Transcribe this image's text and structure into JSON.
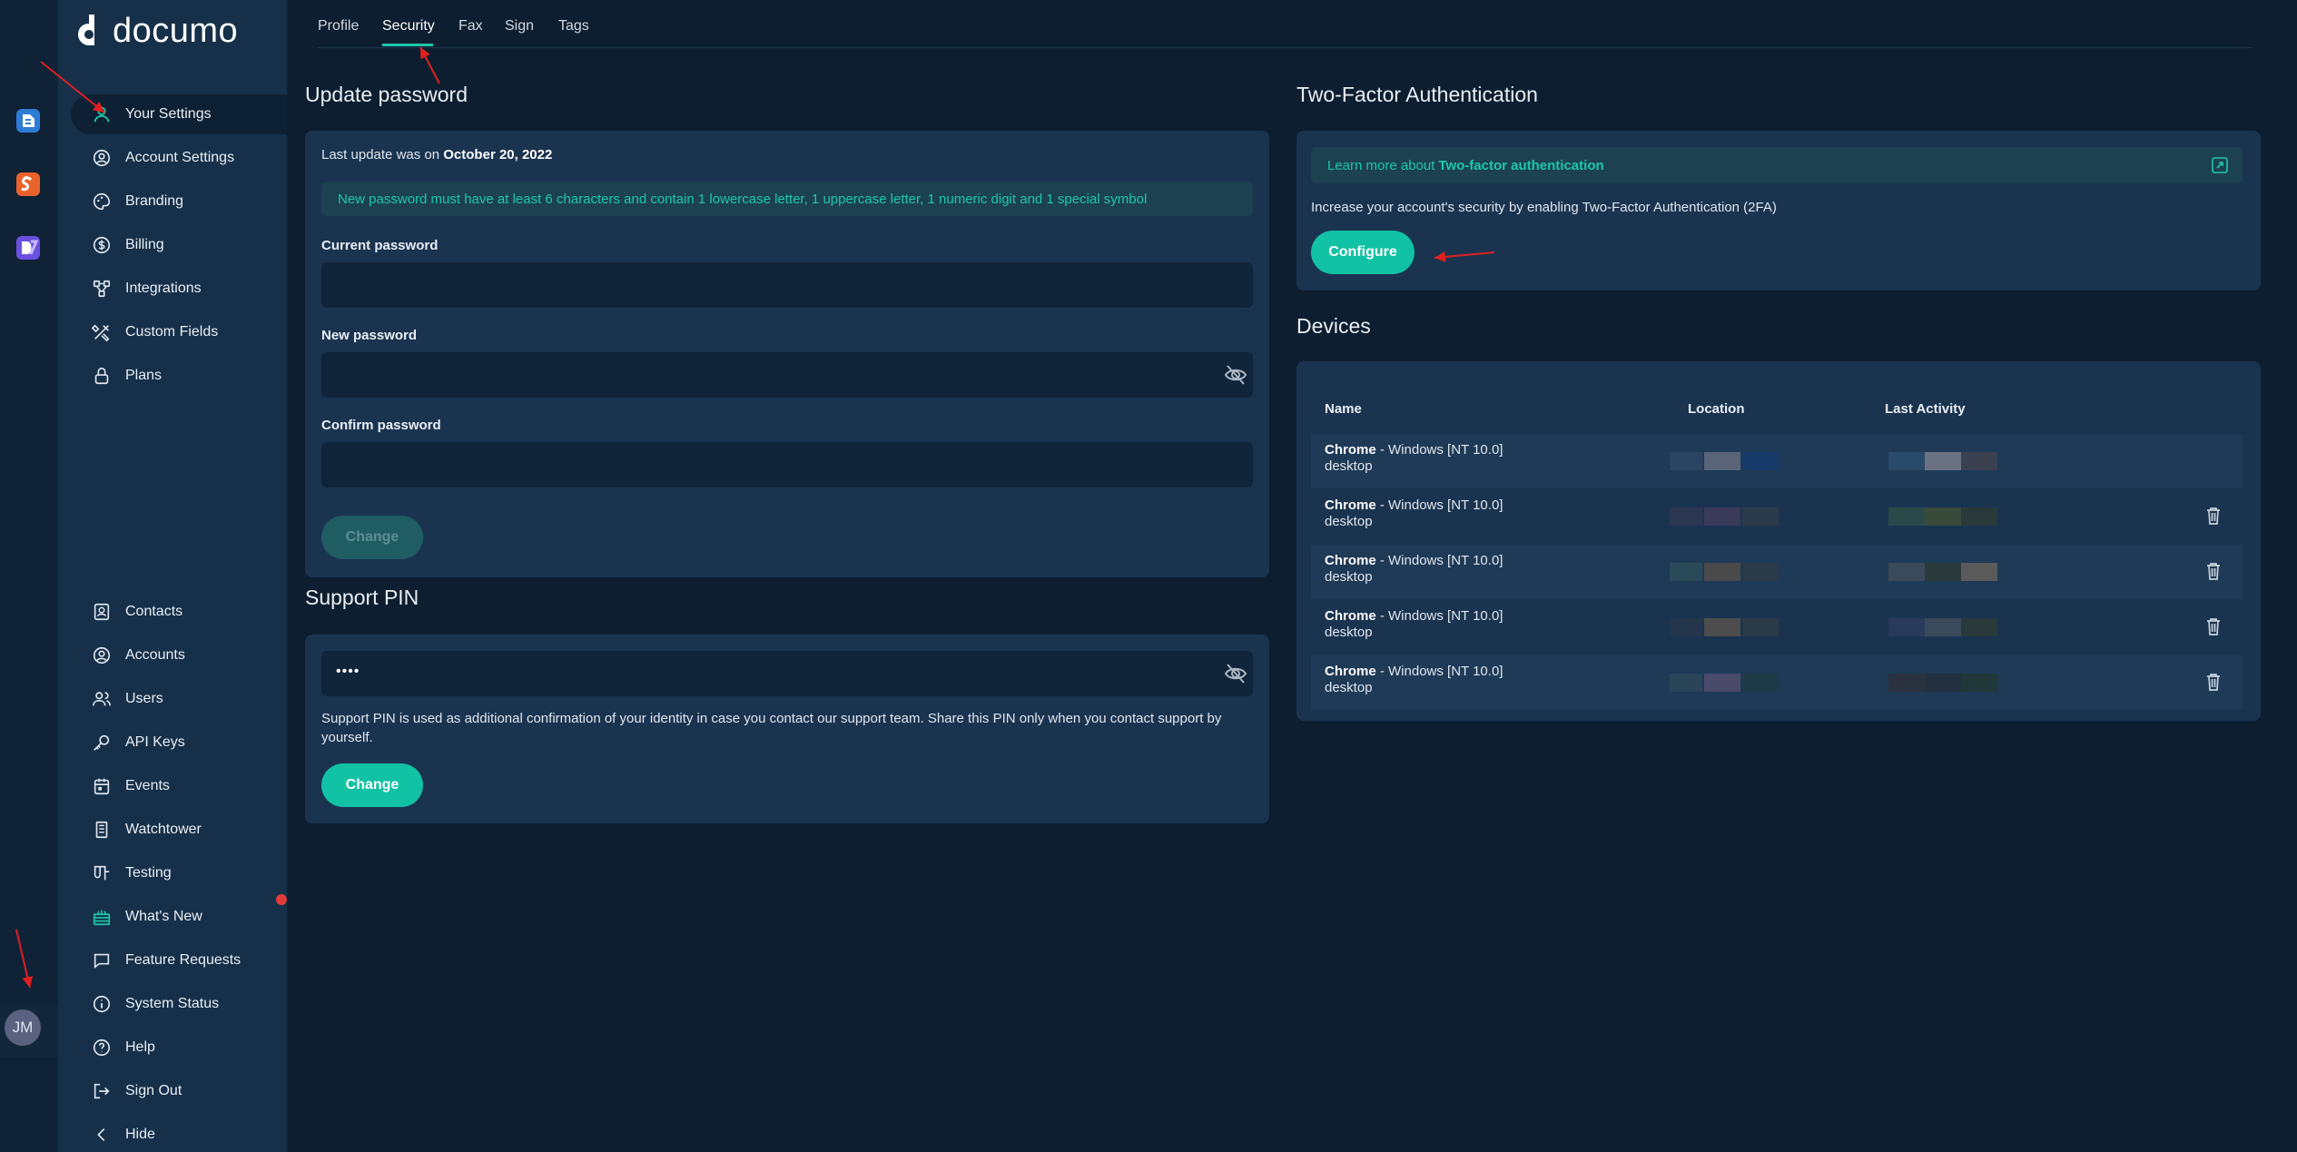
{
  "app": {
    "logo_text": "documo",
    "user_initials": "JM"
  },
  "rail_apps": [
    {
      "name": "documo-app-icon",
      "color": "#2e7bd6"
    },
    {
      "name": "sy-app-icon",
      "color": "#f07a2a"
    },
    {
      "name": "dy-app-icon",
      "color": "#7a5cf0"
    }
  ],
  "sidebar": {
    "top_items": [
      {
        "label": "Your Settings",
        "icon": "user-icon",
        "active": true
      },
      {
        "label": "Account Settings",
        "icon": "user-circle-icon"
      },
      {
        "label": "Branding",
        "icon": "palette-icon"
      },
      {
        "label": "Billing",
        "icon": "dollar-icon"
      },
      {
        "label": "Integrations",
        "icon": "integrations-icon"
      },
      {
        "label": "Custom Fields",
        "icon": "tools-icon"
      },
      {
        "label": "Plans",
        "icon": "lock-icon"
      }
    ],
    "bottom_items": [
      {
        "label": "Contacts",
        "icon": "contacts-icon"
      },
      {
        "label": "Accounts",
        "icon": "user-circle-icon"
      },
      {
        "label": "Users",
        "icon": "users-icon"
      },
      {
        "label": "API Keys",
        "icon": "key-icon"
      },
      {
        "label": "Events",
        "icon": "calendar-icon"
      },
      {
        "label": "Watchtower",
        "icon": "tower-icon"
      },
      {
        "label": "Testing",
        "icon": "flask-icon"
      },
      {
        "label": "What's New",
        "icon": "gift-icon"
      },
      {
        "label": "Feature Requests",
        "icon": "chat-icon"
      },
      {
        "label": "System Status",
        "icon": "info-icon"
      },
      {
        "label": "Help",
        "icon": "help-icon"
      },
      {
        "label": "Sign Out",
        "icon": "signout-icon"
      },
      {
        "label": "Hide",
        "icon": "chevron-left-icon"
      }
    ]
  },
  "tabs": [
    "Profile",
    "Security",
    "Fax",
    "Sign",
    "Tags"
  ],
  "active_tab": "Security",
  "update_password": {
    "title": "Update password",
    "last_update_prefix": "Last update was on ",
    "last_update_date": "October 20, 2022",
    "requirements": "New password must have at least 6 characters and contain 1 lowercase letter, 1 uppercase letter, 1 numeric digit and 1 special symbol",
    "current_label": "Current password",
    "new_label": "New password",
    "confirm_label": "Confirm password",
    "change_label": "Change"
  },
  "support_pin": {
    "title": "Support PIN",
    "value": "••••",
    "description": "Support PIN is used as additional confirmation of your identity in case you contact our support team. Share this PIN only when you contact support by yourself.",
    "change_label": "Change"
  },
  "two_factor": {
    "title": "Two-Factor Authentication",
    "learn_prefix": "Learn more about ",
    "learn_link": "Two-factor authentication",
    "description": "Increase your account's security by enabling Two-Factor Authentication (2FA)",
    "configure_label": "Configure"
  },
  "devices": {
    "title": "Devices",
    "columns": [
      "Name",
      "Location",
      "Last Activity"
    ],
    "rows": [
      {
        "browser": "Chrome",
        "os": " - Windows [NT 10.0]",
        "type": "desktop",
        "deletable": false
      },
      {
        "browser": "Chrome",
        "os": " - Windows [NT 10.0]",
        "type": "desktop",
        "deletable": true
      },
      {
        "browser": "Chrome",
        "os": " - Windows [NT 10.0]",
        "type": "desktop",
        "deletable": true
      },
      {
        "browser": "Chrome",
        "os": " - Windows [NT 10.0]",
        "type": "desktop",
        "deletable": true
      },
      {
        "browser": "Chrome",
        "os": " - Windows [NT 10.0]",
        "type": "desktop",
        "deletable": true
      }
    ]
  },
  "colors": {
    "accent": "#12c2a4",
    "background": "#0d1e30",
    "card": "#1a3450",
    "sidebar": "#163049",
    "annotation": "#e02020"
  }
}
